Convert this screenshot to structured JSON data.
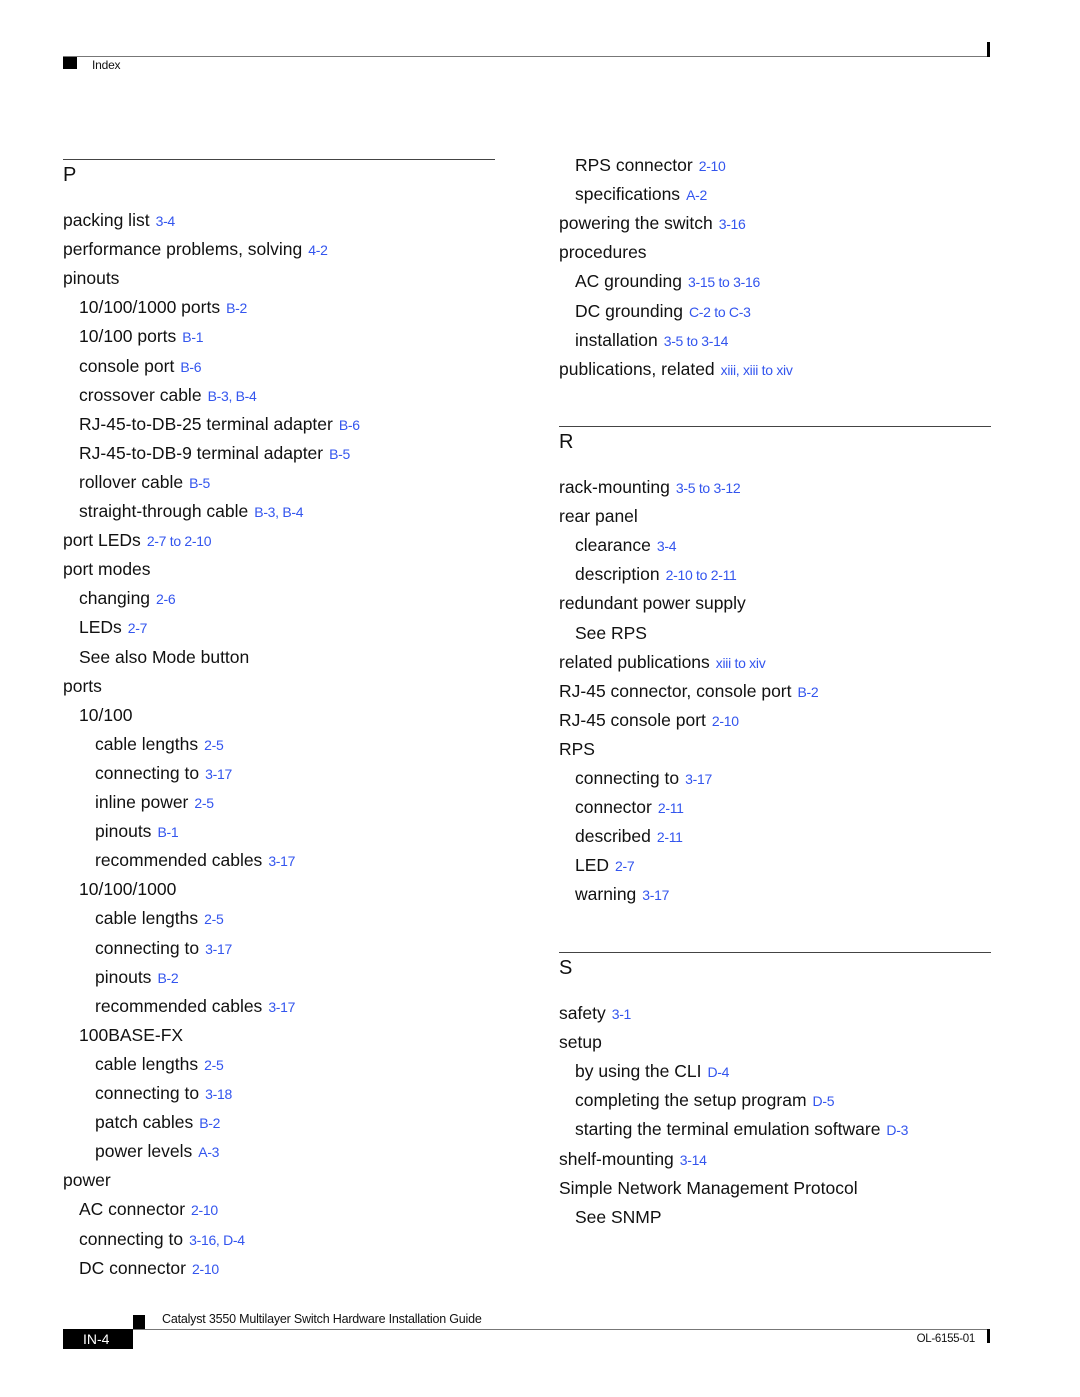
{
  "header": {
    "section_label": "Index"
  },
  "colors": {
    "reference_link": "#3355ee",
    "text": "#111111"
  },
  "left_column": {
    "sections": [
      {
        "letter": "P",
        "entries": [
          {
            "level": 0,
            "term": "packing list",
            "ref": "3-4"
          },
          {
            "level": 0,
            "term": "performance problems, solving",
            "ref": "4-2"
          },
          {
            "level": 0,
            "term": "pinouts",
            "ref": ""
          },
          {
            "level": 1,
            "term": "10/100/1000 ports",
            "ref": "B-2"
          },
          {
            "level": 1,
            "term": "10/100 ports",
            "ref": "B-1"
          },
          {
            "level": 1,
            "term": "console port",
            "ref": "B-6"
          },
          {
            "level": 1,
            "term": "crossover cable",
            "ref": "B-3, B-4"
          },
          {
            "level": 1,
            "term": "RJ-45-to-DB-25 terminal adapter",
            "ref": "B-6"
          },
          {
            "level": 1,
            "term": "RJ-45-to-DB-9 terminal adapter",
            "ref": "B-5"
          },
          {
            "level": 1,
            "term": "rollover cable",
            "ref": "B-5"
          },
          {
            "level": 1,
            "term": "straight-through cable",
            "ref": "B-3, B-4"
          },
          {
            "level": 0,
            "term": "port LEDs",
            "ref": "2-7 to 2-10"
          },
          {
            "level": 0,
            "term": "port modes",
            "ref": ""
          },
          {
            "level": 1,
            "term": "changing",
            "ref": "2-6"
          },
          {
            "level": 1,
            "term": "LEDs",
            "ref": "2-7"
          },
          {
            "level": 1,
            "term": "See also Mode button",
            "ref": ""
          },
          {
            "level": 0,
            "term": "ports",
            "ref": ""
          },
          {
            "level": 1,
            "term": "10/100",
            "ref": ""
          },
          {
            "level": 2,
            "term": "cable lengths",
            "ref": "2-5"
          },
          {
            "level": 2,
            "term": "connecting to",
            "ref": "3-17"
          },
          {
            "level": 2,
            "term": "inline power",
            "ref": "2-5"
          },
          {
            "level": 2,
            "term": "pinouts",
            "ref": "B-1"
          },
          {
            "level": 2,
            "term": "recommended cables",
            "ref": "3-17"
          },
          {
            "level": 1,
            "term": "10/100/1000",
            "ref": ""
          },
          {
            "level": 2,
            "term": "cable lengths",
            "ref": "2-5"
          },
          {
            "level": 2,
            "term": "connecting to",
            "ref": "3-17"
          },
          {
            "level": 2,
            "term": "pinouts",
            "ref": "B-2"
          },
          {
            "level": 2,
            "term": "recommended cables",
            "ref": "3-17"
          },
          {
            "level": 1,
            "term": "100BASE-FX",
            "ref": ""
          },
          {
            "level": 2,
            "term": "cable lengths",
            "ref": "2-5"
          },
          {
            "level": 2,
            "term": "connecting to",
            "ref": "3-18"
          },
          {
            "level": 2,
            "term": "patch cables",
            "ref": "B-2"
          },
          {
            "level": 2,
            "term": "power levels",
            "ref": "A-3"
          },
          {
            "level": 0,
            "term": "power",
            "ref": ""
          },
          {
            "level": 1,
            "term": "AC connector",
            "ref": "2-10"
          },
          {
            "level": 1,
            "term": "connecting to",
            "ref": "3-16, D-4"
          },
          {
            "level": 1,
            "term": "DC connector",
            "ref": "2-10"
          }
        ]
      }
    ]
  },
  "right_column": {
    "continued_entries": [
      {
        "level": 1,
        "term": "RPS connector",
        "ref": "2-10"
      },
      {
        "level": 1,
        "term": "specifications",
        "ref": "A-2"
      },
      {
        "level": 0,
        "term": "powering the switch",
        "ref": "3-16"
      },
      {
        "level": 0,
        "term": "procedures",
        "ref": ""
      },
      {
        "level": 1,
        "term": "AC grounding",
        "ref": "3-15 to 3-16"
      },
      {
        "level": 1,
        "term": "DC grounding",
        "ref": "C-2 to C-3"
      },
      {
        "level": 1,
        "term": "installation",
        "ref": "3-5 to 3-14"
      },
      {
        "level": 0,
        "term": "publications, related",
        "ref": "xiii, xiii to xiv"
      }
    ],
    "sections": [
      {
        "letter": "R",
        "entries": [
          {
            "level": 0,
            "term": "rack-mounting",
            "ref": "3-5 to 3-12"
          },
          {
            "level": 0,
            "term": "rear panel",
            "ref": ""
          },
          {
            "level": 1,
            "term": "clearance",
            "ref": "3-4"
          },
          {
            "level": 1,
            "term": "description",
            "ref": "2-10 to 2-11"
          },
          {
            "level": 0,
            "term": "redundant power supply",
            "ref": ""
          },
          {
            "level": 1,
            "term": "See RPS",
            "ref": ""
          },
          {
            "level": 0,
            "term": "related publications",
            "ref": "xiii to xiv"
          },
          {
            "level": 0,
            "term": "RJ-45 connector, console port",
            "ref": "B-2"
          },
          {
            "level": 0,
            "term": "RJ-45 console port",
            "ref": "2-10"
          },
          {
            "level": 0,
            "term": "RPS",
            "ref": ""
          },
          {
            "level": 1,
            "term": "connecting to",
            "ref": "3-17"
          },
          {
            "level": 1,
            "term": "connector",
            "ref": "2-11"
          },
          {
            "level": 1,
            "term": "described",
            "ref": "2-11"
          },
          {
            "level": 1,
            "term": "LED",
            "ref": "2-7"
          },
          {
            "level": 1,
            "term": "warning",
            "ref": "3-17"
          }
        ]
      },
      {
        "letter": "S",
        "entries": [
          {
            "level": 0,
            "term": "safety",
            "ref": "3-1"
          },
          {
            "level": 0,
            "term": "setup",
            "ref": ""
          },
          {
            "level": 1,
            "term": "by using the CLI",
            "ref": "D-4"
          },
          {
            "level": 1,
            "term": "completing the setup program",
            "ref": "D-5"
          },
          {
            "level": 1,
            "term": "starting the terminal emulation software",
            "ref": "D-3"
          },
          {
            "level": 0,
            "term": "shelf-mounting",
            "ref": "3-14"
          },
          {
            "level": 0,
            "term": "Simple Network Management Protocol",
            "ref": ""
          },
          {
            "level": 1,
            "term": "See SNMP",
            "ref": ""
          }
        ]
      }
    ]
  },
  "footer": {
    "book_title": "Catalyst 3550 Multilayer Switch Hardware Installation Guide",
    "page_number": "IN-4",
    "doc_number": "OL-6155-01"
  }
}
